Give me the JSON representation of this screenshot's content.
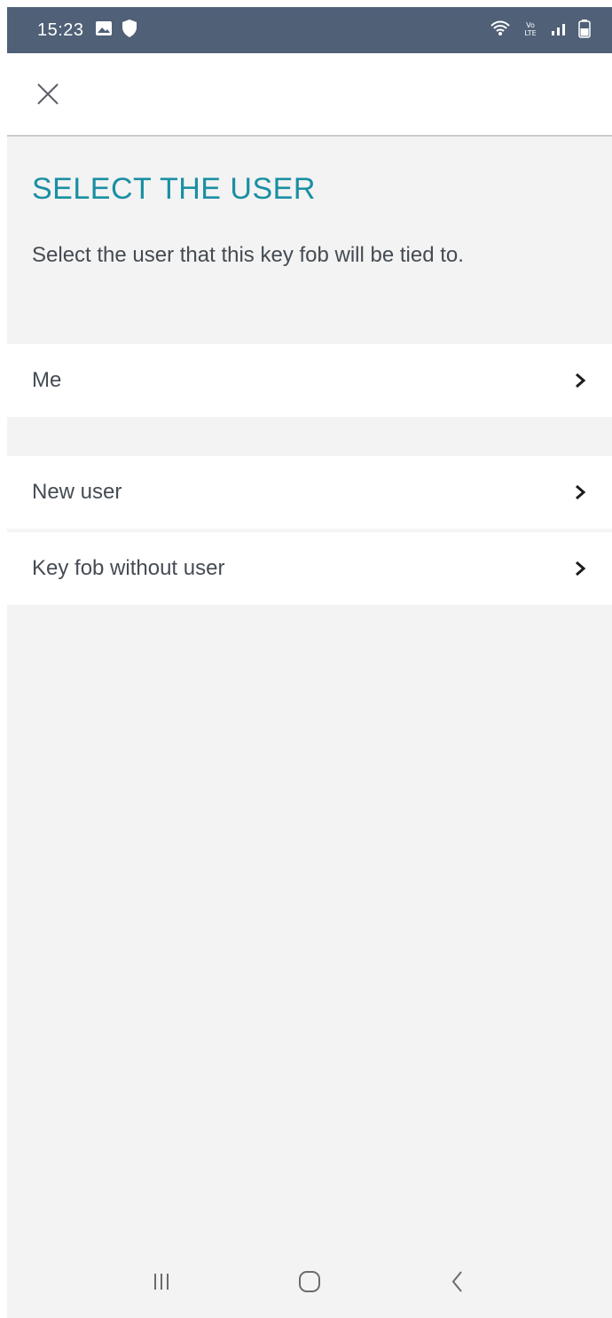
{
  "status_bar": {
    "time": "15:23",
    "left_icons": [
      "gallery-icon",
      "shield-icon"
    ],
    "right_icons": [
      "wifi-icon",
      "volte-lte-icon",
      "signal-icon",
      "battery-icon"
    ],
    "volte_text": "VoLTE",
    "background_color": "#4f6077"
  },
  "app_bar": {
    "close_icon": "close-icon"
  },
  "header": {
    "title": "SELECT THE USER",
    "subtitle": "Select the user that this key fob will be tied to.",
    "title_color": "#1a8fa3"
  },
  "options": [
    {
      "label": "Me",
      "icon": "chevron-right-icon"
    },
    {
      "label": "New user",
      "icon": "chevron-right-icon"
    },
    {
      "label": "Key fob without user",
      "icon": "chevron-right-icon"
    }
  ],
  "nav_bar": {
    "buttons": [
      "recents-icon",
      "home-icon",
      "back-icon"
    ]
  }
}
